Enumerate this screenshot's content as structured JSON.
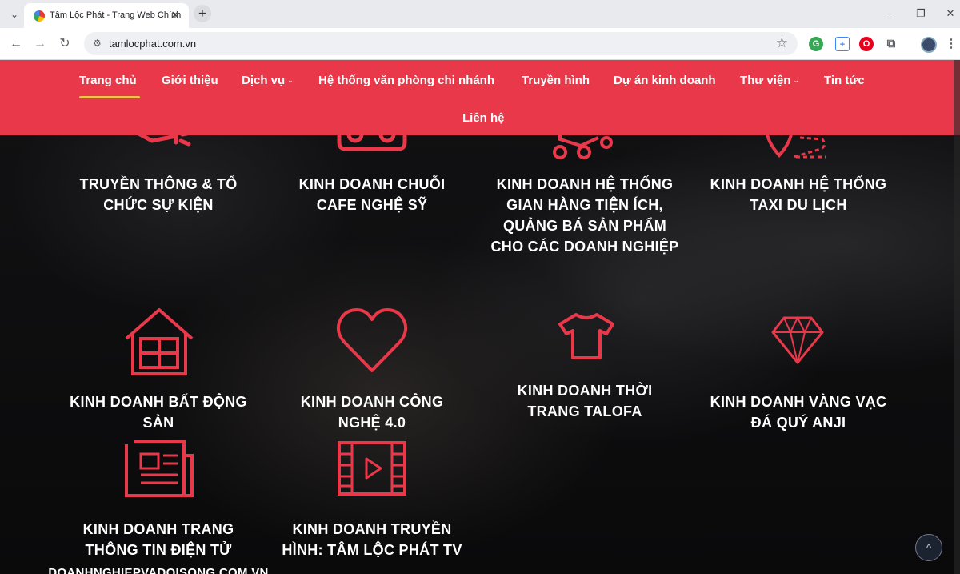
{
  "browser": {
    "tab_title": "Tâm Lộc Phát - Trang Web Chính",
    "url": "tamlocphat.com.vn",
    "tab_close": "✕",
    "new_tab": "+",
    "window_controls": {
      "minimize": "—",
      "restore": "❐",
      "close": "✕"
    }
  },
  "nav": {
    "items": [
      {
        "label": "Trang chủ",
        "active": true
      },
      {
        "label": "Giới thiệu"
      },
      {
        "label": "Dịch vụ",
        "dropdown": true
      },
      {
        "label": "Hệ thống văn phòng chi nhánh"
      },
      {
        "label": "Truyền hình"
      },
      {
        "label": "Dự án kinh doanh"
      },
      {
        "label": "Thư viện",
        "dropdown": true
      },
      {
        "label": "Tin tức"
      },
      {
        "label": "Liên hệ"
      }
    ],
    "caret": "⌄",
    "bar_color": "#e8384a",
    "underline_color": "#f6c24b"
  },
  "services": {
    "icon_color": "#e8384a",
    "items": [
      {
        "title": "TRUYỀN THÔNG & TỔ CHỨC SỰ KIỆN",
        "icon": "megaphone-icon"
      },
      {
        "title": "KINH DOANH CHUỖI CAFE NGHỆ SỸ",
        "icon": "camera-icon"
      },
      {
        "title": "KINH DOANH HỆ THỐNG GIAN HÀNG TIỆN ÍCH, QUẢNG BÁ SẢN PHẨM CHO CÁC DOANH NGHIỆP",
        "icon": "network-icon"
      },
      {
        "title": "KINH DOANH HỆ THỐNG TAXI DU LỊCH",
        "icon": "route-pin-icon"
      },
      {
        "title": "KINH DOANH BẤT ĐỘNG SẢN",
        "icon": "house-icon"
      },
      {
        "title": "KINH DOANH CÔNG NGHỆ 4.0",
        "icon": "heart-icon"
      },
      {
        "title": "KINH DOANH THỜI TRANG TALOFA",
        "icon": "tshirt-icon"
      },
      {
        "title": "KINH DOANH VÀNG VẠC ĐÁ QUÝ ANJI",
        "icon": "diamond-icon"
      },
      {
        "title": "KINH DOANH TRANG THÔNG TIN ĐIỆN TỬ",
        "subtitle": "DOANHNGHIEPVADOISONG.COM.VN",
        "icon": "newspaper-icon"
      },
      {
        "title": "KINH DOANH TRUYỀN HÌNH: TÂM LỘC PHÁT TV",
        "icon": "film-icon"
      }
    ]
  },
  "scroll_top": "^"
}
